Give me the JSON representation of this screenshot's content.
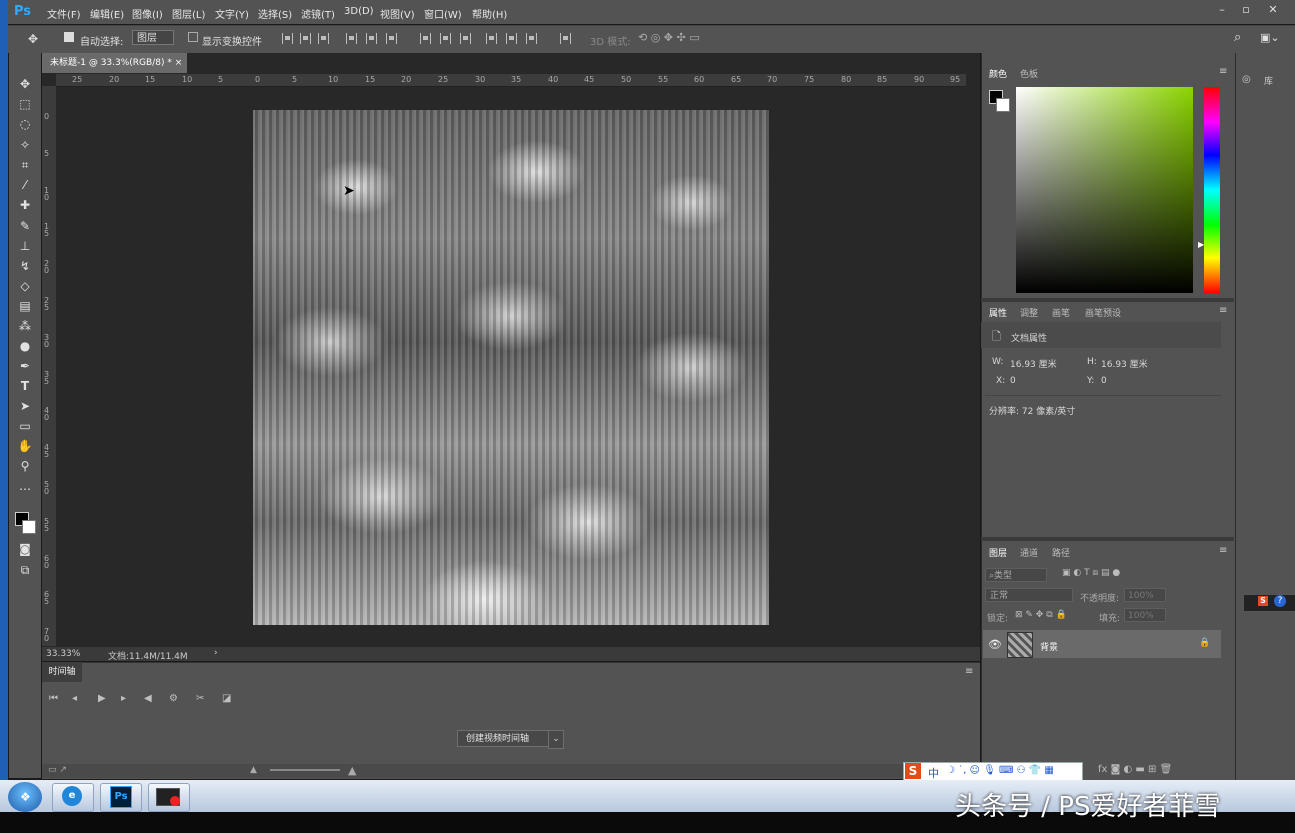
{
  "app": {
    "logo": "Ps"
  },
  "menu": [
    "文件(F)",
    "编辑(E)",
    "图像(I)",
    "图层(L)",
    "文字(Y)",
    "选择(S)",
    "滤镜(T)",
    "3D(D)",
    "视图(V)",
    "窗口(W)",
    "帮助(H)"
  ],
  "window_controls": {
    "minimize": "–",
    "restore": "▫",
    "close": "✕"
  },
  "options": {
    "auto_select_label": "自动选择:",
    "auto_select_value": "图层",
    "show_transform": "显示变换控件",
    "mode_3d": "3D 模式:"
  },
  "document": {
    "tab_title": "未标题-1 @ 33.3%(RGB/8) *",
    "zoom": "33.33%",
    "doc_info": "文档:11.4M/11.4M",
    "ruler_h": [
      "25",
      "20",
      "15",
      "10",
      "5",
      "0",
      "5",
      "10",
      "15",
      "20",
      "25",
      "30",
      "35",
      "40",
      "45",
      "50",
      "55",
      "60",
      "65",
      "70",
      "75",
      "80",
      "85",
      "90",
      "95"
    ],
    "ruler_v": [
      "0",
      "5",
      "1 0",
      "1 5",
      "2 0",
      "2 5",
      "3 0",
      "3 5",
      "4 0",
      "4 5",
      "5 0",
      "5 5",
      "6 0",
      "6 5",
      "7 0"
    ]
  },
  "timeline": {
    "tab": "时间轴",
    "create_button": "创建视频时间轴"
  },
  "panels": {
    "color_tabs": [
      "颜色",
      "色板"
    ],
    "props_tabs": [
      "属性",
      "调整",
      "画笔",
      "画笔预设"
    ],
    "props_title": "文档属性",
    "w_label": "W:",
    "w_value": "16.93 厘米",
    "h_label": "H:",
    "h_value": "16.93 厘米",
    "x_label": "X:",
    "x_value": "0",
    "y_label": "Y:",
    "y_value": "0",
    "resolution": "分辨率: 72 像素/英寸",
    "layers_tabs": [
      "图层",
      "通道",
      "路径"
    ],
    "layer_kind": "类型",
    "blend_mode": "正常",
    "opacity_label": "不透明度:",
    "opacity_value": "100%",
    "lock_label": "锁定:",
    "fill_label": "填充:",
    "fill_value": "100%",
    "layer_name": "背景",
    "library_label": "库"
  },
  "watermark": "头条号 / PS爱好者菲雪",
  "ime": {
    "logo": "S",
    "mode": "中"
  },
  "colors": {
    "accent": "#31a8ff",
    "taskbar": "#cfd8e6",
    "panel": "#535353"
  }
}
